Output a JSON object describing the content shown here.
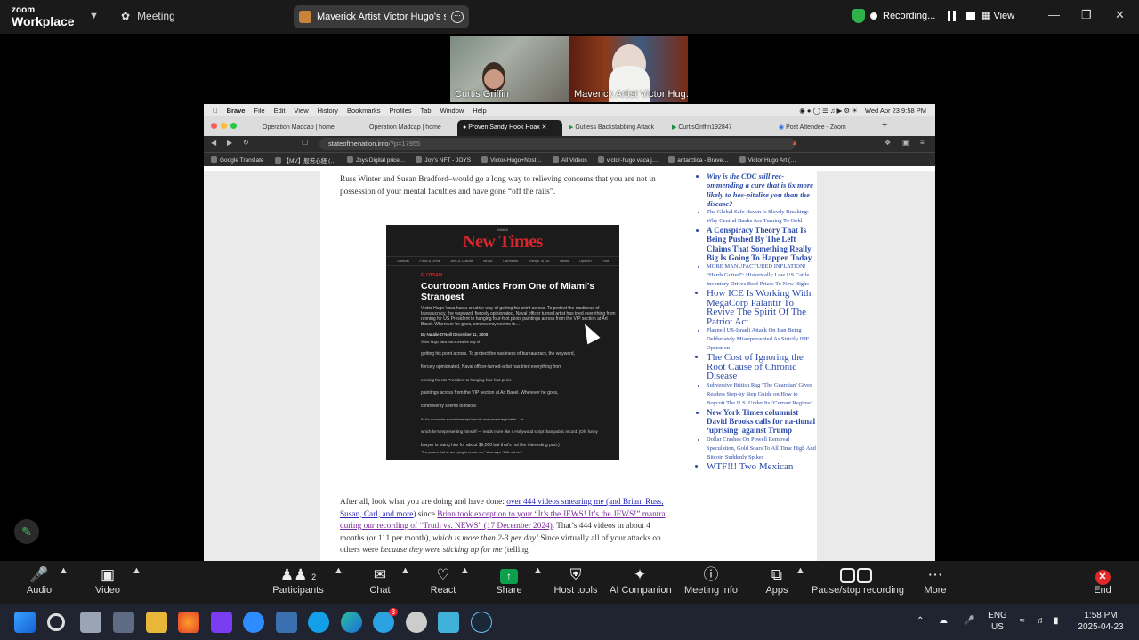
{
  "zoom_titlebar": {
    "logo_line1": "zoom",
    "logo_line2": "Workplace",
    "meeting_label": "Meeting",
    "share_title": "Maverick Artist Victor Hugo's scr",
    "recording_label": "Recording...",
    "view_label": "View"
  },
  "participants_strip": [
    {
      "name": "Curtis Griffin"
    },
    {
      "name": "Maverick Artist Victor Hug..."
    }
  ],
  "mac_menubar": {
    "app": "Brave",
    "items": [
      "File",
      "Edit",
      "View",
      "History",
      "Bookmarks",
      "Profiles",
      "Tab",
      "Window",
      "Help"
    ],
    "datetime": "Wed Apr 23  9:58 PM"
  },
  "browser_tabs": [
    {
      "title": "Operation Madcap | home"
    },
    {
      "title": "Operation Madcap | home"
    },
    {
      "title": "Proven Sandy Hook Hoax"
    },
    {
      "title": "Gutless Backstabbing Attack"
    },
    {
      "title": "CurtisGriffin192847"
    },
    {
      "title": "Post Attendee - Zoom"
    }
  ],
  "address_bar": {
    "host": "stateofthenation.info",
    "path": "/?p=17955"
  },
  "bookmarks": [
    "Google Translate",
    "【MV】般若心経 (…",
    "Joys Digital price…",
    "Joy's NFT - JOYS",
    "Victor-Hugo+Nost…",
    "All Videos",
    "victor-hugo vaca j…",
    "antarctica - Brave…",
    "Victor Hugo Art (…"
  ],
  "article": {
    "intro": "Russ Winter and Susan Bradford–would go a long way to relieving concerns that you are not in possession of your mental faculties and have gone “off the rails”.",
    "embedded_image": {
      "masthead": "New Times",
      "masthead_prefix": "MIAMI",
      "menu": [
        "Opinion",
        "Food & Drink",
        "Arts & Culture",
        "Music",
        "Cannabis",
        "Things To Do",
        "News",
        "Opinion",
        "Find"
      ],
      "kicker": "FLOTSAM",
      "headline": "Courtroom Antics From One of Miami's Strangest",
      "lead": "Victor Hugo Vaca has a creative way of getting his point across. To protect the nastiness of bureaucracy, the wayward, fiercely opinionated, Naval officer turned artist has tried everything from running for US President to hanging four-foot penis paintings across from the VIP section at Art Basel. Wherever he goes, controversy seems to…",
      "byline": "By Natalie O'Neill    December 11, 2008",
      "lines": [
        "Victor Hugo Vaca has a creative way of",
        "getting his point across. To protect the nastiness of bureaucracy, the wayward,",
        "fiercely opinionated, Naval officer-turned-artist has tried everything from",
        "running for US President to hanging four-foot penis",
        "paintings across from the VIP section at Art Basel. Wherever he goes,",
        "controversy seems to follow.",
        "So it's no wonder a court transcript from his most recent legal battle — in",
        "which he's representing himself — reads more like a Hollywood script than public record. (Oh, funny",
        "lawyer is suing him for about $9,000 but that's not the interesting part.)",
        "\"The powers that be are trying to censor me,\" Vaca says. \"Little old me.\""
      ]
    },
    "bottom": {
      "t1": "After all, look what you are doing and have done: ",
      "link1": "over 444 videos smearing me (and Brian, Russ, Susan, Carl, and more)",
      "t2": " since ",
      "link2": "Brian took exception to your “It’s the JEWS! It’s the JEWS!” mantra during our recording of “Truth vs. NEWS” (17 December 2024)",
      "t3": ". That’s 444 videos in about 4 months (or 111 per month), ",
      "t4": "which is more than 2-3 per day!",
      "t5": " Since virtually all of your attacks on others were ",
      "t6": "because they were sticking up for me",
      "t7": " (telling"
    }
  },
  "sidebar_items": [
    {
      "text": "Why is the CDC still rec-ommending a cure that is 6x more likely to hos-pitalize you than the disease?",
      "style": "bi"
    },
    {
      "text": "The Global Safe Haven Is Slowly Breaking: Why Central Banks Are Turning To Gold",
      "style": "s"
    },
    {
      "text": "A Conspiracy Theory That Is Being Pushed By The Left Claims That Something Really Big Is Going To Happen Today",
      "style": "b"
    },
    {
      "text": "MORE MANUFACTURED INFLATION! “Herds Gutted”: Historically Low US Cattle Inventory Drives Beef Prices To New Highs",
      "style": "s"
    },
    {
      "text": "How ICE Is Working With MegaCorp Palantir To Revive The Spirit Of The Patriot Act",
      "style": "m"
    },
    {
      "text": "Planned US-Israeli Attack On Iran Being Deliberately Misrepresented As Strictly IDF Operation",
      "style": "s"
    },
    {
      "text": "The Cost of Ignoring the Root Cause of Chronic Disease",
      "style": "m"
    },
    {
      "text": "Subversive British Rag ‘The Guardian’ Gives Readers Step-by Step Guide on How to Boycott The U.S. Under Its ‘Current Regime’",
      "style": "s"
    },
    {
      "text": "New York Times columnist David Brooks calls for na-tional ‘uprising’ against Trump",
      "style": "b"
    },
    {
      "text": "Dollar Crashes On Powell Removal Speculation, Gold Soars To All Time High And Bitcoin Suddenly Spikes",
      "style": "s"
    },
    {
      "text": "WTF!!! Two Mexican",
      "style": "m"
    }
  ],
  "zoom_toolbar": {
    "audio": "Audio",
    "video": "Video",
    "participants": "Participants",
    "participants_count": "2",
    "chat": "Chat",
    "react": "React",
    "share": "Share",
    "host_tools": "Host tools",
    "ai_companion": "AI Companion",
    "meeting_info": "Meeting info",
    "apps": "Apps",
    "pause_stop": "Pause/stop recording",
    "more": "More",
    "end": "End"
  },
  "taskbar": {
    "lang_line1": "ENG",
    "lang_line2": "US",
    "time": "1:58 PM",
    "date": "2025-04-23",
    "telegram_badge": "3"
  },
  "colors": {
    "zoom_bg": "#1a1a1a",
    "share_green": "#0e9f4d",
    "end_red": "#e02828",
    "link_blue": "#2a2ab8",
    "newtimes_red": "#d8262a"
  }
}
